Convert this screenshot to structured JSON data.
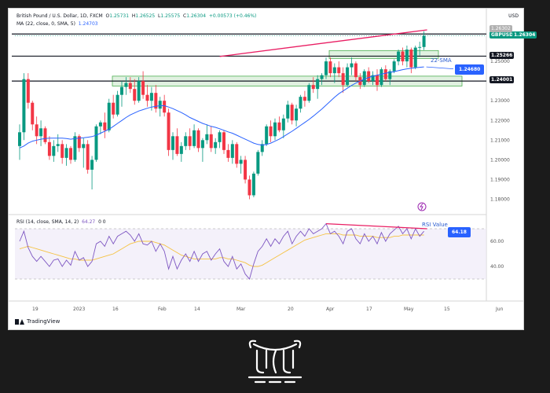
{
  "legend": {
    "symbol_line": "British Pound / U.S. Dollar, 1D, FXCM",
    "o_label": "O",
    "o_value": "1.25731",
    "h_label": "H",
    "h_value": "1.26525",
    "l_label": "L",
    "l_value": "1.25575",
    "c_label": "C",
    "c_value": "1.26304",
    "change": "+0.00573 (+0.46%)",
    "ma_line": "MA (22, close, 0, SMA, 5)",
    "ma_value": "1.24703",
    "rsi_line": "RSI (14, close, SMA, 14, 2)",
    "rsi_value": "64.27",
    "rsi_extra": "0 0"
  },
  "axis_currency": "USD",
  "branding": "TradingView",
  "price_tags": {
    "symbol": "GBPUSD",
    "last": "1.26304",
    "top_partial": "1.26302",
    "resistance_1": "1.25266",
    "resistance_2": "1.24001",
    "sma_value": "1.24680",
    "rsi_value": "64.18"
  },
  "annotations": {
    "sma_label": "22-SMA",
    "rsi_label": "RSI Value"
  },
  "colors": {
    "up": "#089981",
    "down": "#f23645",
    "sma": "#2962ff",
    "rsi": "#7e57c2",
    "rsi_ma": "#f5c242",
    "divergence": "#e91e63",
    "zone_fill": "#c8e6c9",
    "zone_stroke": "#4caf50",
    "page_bg": "#1b1b1b"
  },
  "chart_data": {
    "type": "candlestick",
    "y_range": [
      1.175,
      1.268
    ],
    "y_ticks": [
      "1.18000",
      "1.19000",
      "1.20000",
      "1.21000",
      "1.22000",
      "1.23000",
      "1.25000"
    ],
    "x_ticks": [
      "19",
      "2023",
      "16",
      "Feb",
      "14",
      "Mar",
      "20",
      "Apr",
      "17",
      "May",
      "15",
      "Jun"
    ],
    "rsi_range": [
      25,
      75
    ],
    "rsi_ticks": [
      "60.00",
      "40.00"
    ],
    "rsi_levels": [
      70,
      30
    ],
    "horizontal_levels": [
      1.2639,
      1.25266,
      1.24001
    ],
    "zones": [
      {
        "low": 1.2375,
        "high": 1.2425
      },
      {
        "low": 1.2515,
        "high": 1.2555
      }
    ],
    "candles": [
      [
        1.207,
        1.218,
        1.2,
        1.214
      ],
      [
        1.214,
        1.244,
        1.21,
        1.241
      ],
      [
        1.241,
        1.244,
        1.226,
        1.229
      ],
      [
        1.229,
        1.23,
        1.215,
        1.218
      ],
      [
        1.218,
        1.222,
        1.208,
        1.212
      ],
      [
        1.212,
        1.22,
        1.207,
        1.216
      ],
      [
        1.216,
        1.217,
        1.208,
        1.209
      ],
      [
        1.209,
        1.212,
        1.2,
        1.202
      ],
      [
        1.202,
        1.21,
        1.199,
        1.207
      ],
      [
        1.207,
        1.213,
        1.204,
        1.208
      ],
      [
        1.208,
        1.21,
        1.198,
        1.201
      ],
      [
        1.201,
        1.208,
        1.197,
        1.206
      ],
      [
        1.206,
        1.207,
        1.198,
        1.2
      ],
      [
        1.2,
        1.214,
        1.199,
        1.212
      ],
      [
        1.212,
        1.213,
        1.204,
        1.206
      ],
      [
        1.206,
        1.211,
        1.196,
        1.208
      ],
      [
        1.208,
        1.21,
        1.193,
        1.195
      ],
      [
        1.195,
        1.202,
        1.185,
        1.2
      ],
      [
        1.2,
        1.218,
        1.199,
        1.217
      ],
      [
        1.217,
        1.22,
        1.213,
        1.219
      ],
      [
        1.219,
        1.224,
        1.211,
        1.215
      ],
      [
        1.215,
        1.231,
        1.214,
        1.229
      ],
      [
        1.229,
        1.233,
        1.221,
        1.223
      ],
      [
        1.223,
        1.235,
        1.222,
        1.233
      ],
      [
        1.233,
        1.24,
        1.227,
        1.237
      ],
      [
        1.237,
        1.242,
        1.233,
        1.239
      ],
      [
        1.239,
        1.242,
        1.234,
        1.236
      ],
      [
        1.236,
        1.241,
        1.228,
        1.23
      ],
      [
        1.23,
        1.242,
        1.229,
        1.24
      ],
      [
        1.24,
        1.245,
        1.231,
        1.233
      ],
      [
        1.233,
        1.238,
        1.227,
        1.23
      ],
      [
        1.23,
        1.237,
        1.225,
        1.234
      ],
      [
        1.234,
        1.238,
        1.224,
        1.226
      ],
      [
        1.226,
        1.232,
        1.222,
        1.23
      ],
      [
        1.23,
        1.233,
        1.222,
        1.224
      ],
      [
        1.224,
        1.226,
        1.202,
        1.205
      ],
      [
        1.205,
        1.214,
        1.2,
        1.212
      ],
      [
        1.212,
        1.216,
        1.202,
        1.203
      ],
      [
        1.203,
        1.209,
        1.199,
        1.207
      ],
      [
        1.207,
        1.214,
        1.205,
        1.212
      ],
      [
        1.212,
        1.216,
        1.205,
        1.207
      ],
      [
        1.207,
        1.218,
        1.206,
        1.215
      ],
      [
        1.215,
        1.216,
        1.204,
        1.206
      ],
      [
        1.206,
        1.211,
        1.199,
        1.21
      ],
      [
        1.21,
        1.218,
        1.208,
        1.213
      ],
      [
        1.213,
        1.217,
        1.204,
        1.206
      ],
      [
        1.206,
        1.211,
        1.203,
        1.209
      ],
      [
        1.209,
        1.215,
        1.206,
        1.214
      ],
      [
        1.214,
        1.215,
        1.203,
        1.205
      ],
      [
        1.205,
        1.208,
        1.199,
        1.201
      ],
      [
        1.201,
        1.21,
        1.198,
        1.208
      ],
      [
        1.208,
        1.209,
        1.196,
        1.198
      ],
      [
        1.198,
        1.202,
        1.193,
        1.2
      ],
      [
        1.2,
        1.202,
        1.188,
        1.19
      ],
      [
        1.19,
        1.192,
        1.18,
        1.182
      ],
      [
        1.182,
        1.194,
        1.181,
        1.193
      ],
      [
        1.193,
        1.205,
        1.192,
        1.204
      ],
      [
        1.204,
        1.21,
        1.202,
        1.208
      ],
      [
        1.208,
        1.218,
        1.207,
        1.217
      ],
      [
        1.217,
        1.22,
        1.209,
        1.212
      ],
      [
        1.212,
        1.221,
        1.21,
        1.219
      ],
      [
        1.219,
        1.222,
        1.214,
        1.215
      ],
      [
        1.215,
        1.223,
        1.211,
        1.221
      ],
      [
        1.221,
        1.23,
        1.219,
        1.228
      ],
      [
        1.228,
        1.229,
        1.218,
        1.22
      ],
      [
        1.22,
        1.228,
        1.217,
        1.226
      ],
      [
        1.226,
        1.233,
        1.224,
        1.232
      ],
      [
        1.232,
        1.235,
        1.227,
        1.23
      ],
      [
        1.23,
        1.239,
        1.229,
        1.238
      ],
      [
        1.238,
        1.242,
        1.234,
        1.236
      ],
      [
        1.236,
        1.243,
        1.231,
        1.241
      ],
      [
        1.241,
        1.244,
        1.238,
        1.243
      ],
      [
        1.243,
        1.252,
        1.241,
        1.25
      ],
      [
        1.25,
        1.252,
        1.242,
        1.244
      ],
      [
        1.244,
        1.249,
        1.239,
        1.247
      ],
      [
        1.247,
        1.25,
        1.242,
        1.244
      ],
      [
        1.244,
        1.247,
        1.234,
        1.238
      ],
      [
        1.238,
        1.249,
        1.237,
        1.247
      ],
      [
        1.247,
        1.252,
        1.243,
        1.249
      ],
      [
        1.249,
        1.25,
        1.24,
        1.242
      ],
      [
        1.242,
        1.244,
        1.236,
        1.238
      ],
      [
        1.238,
        1.246,
        1.237,
        1.245
      ],
      [
        1.245,
        1.247,
        1.239,
        1.24
      ],
      [
        1.24,
        1.245,
        1.238,
        1.243
      ],
      [
        1.243,
        1.246,
        1.235,
        1.238
      ],
      [
        1.238,
        1.247,
        1.237,
        1.246
      ],
      [
        1.246,
        1.248,
        1.24,
        1.241
      ],
      [
        1.241,
        1.246,
        1.238,
        1.245
      ],
      [
        1.245,
        1.251,
        1.244,
        1.25
      ],
      [
        1.25,
        1.256,
        1.248,
        1.255
      ],
      [
        1.255,
        1.257,
        1.248,
        1.25
      ],
      [
        1.25,
        1.258,
        1.247,
        1.256
      ],
      [
        1.256,
        1.257,
        1.244,
        1.247
      ],
      [
        1.247,
        1.258,
        1.246,
        1.257
      ],
      [
        1.257,
        1.26,
        1.253,
        1.2573
      ],
      [
        1.2573,
        1.2653,
        1.2558,
        1.263
      ]
    ],
    "sma": [
      1.206,
      1.207,
      1.2085,
      1.2095,
      1.21,
      1.2105,
      1.2108,
      1.211,
      1.211,
      1.211,
      1.211,
      1.2108,
      1.2105,
      1.2108,
      1.211,
      1.2112,
      1.2115,
      1.2118,
      1.2125,
      1.2135,
      1.2145,
      1.2155,
      1.217,
      1.2185,
      1.22,
      1.2215,
      1.2228,
      1.2238,
      1.2248,
      1.2255,
      1.2262,
      1.2268,
      1.2272,
      1.2275,
      1.2275,
      1.2268,
      1.226,
      1.225,
      1.224,
      1.2228,
      1.2215,
      1.2205,
      1.2195,
      1.2185,
      1.2178,
      1.217,
      1.2165,
      1.2158,
      1.215,
      1.2142,
      1.2135,
      1.2125,
      1.2115,
      1.2105,
      1.2095,
      1.2085,
      1.2078,
      1.2075,
      1.2078,
      1.2085,
      1.2095,
      1.2105,
      1.2118,
      1.2132,
      1.2145,
      1.216,
      1.2175,
      1.219,
      1.2205,
      1.2222,
      1.224,
      1.2258,
      1.2278,
      1.2298,
      1.2318,
      1.2336,
      1.235,
      1.2364,
      1.2378,
      1.239,
      1.24,
      1.241,
      1.2418,
      1.2425,
      1.243,
      1.2435,
      1.244,
      1.2444,
      1.2448,
      1.2453,
      1.2458,
      1.2462,
      1.2465,
      1.2468,
      1.247,
      1.2472
    ],
    "rsi": [
      60,
      68,
      55,
      48,
      44,
      48,
      44,
      40,
      45,
      46,
      40,
      45,
      41,
      52,
      45,
      47,
      40,
      44,
      58,
      60,
      56,
      64,
      58,
      64,
      66,
      68,
      65,
      60,
      66,
      58,
      57,
      60,
      52,
      58,
      52,
      38,
      48,
      38,
      45,
      50,
      44,
      52,
      44,
      50,
      52,
      45,
      50,
      54,
      44,
      40,
      48,
      38,
      42,
      34,
      30,
      42,
      52,
      56,
      62,
      56,
      62,
      58,
      64,
      68,
      58,
      64,
      68,
      64,
      70,
      66,
      68,
      70,
      74,
      66,
      68,
      64,
      58,
      68,
      70,
      62,
      58,
      66,
      60,
      64,
      58,
      67,
      60,
      66,
      69,
      72,
      66,
      70,
      62,
      70,
      64,
      68
    ],
    "rsi_ma": [
      54,
      55,
      56,
      55,
      54,
      53,
      52,
      51,
      50,
      49,
      48,
      47,
      46,
      46,
      45,
      45,
      45,
      45,
      46,
      47,
      48,
      49,
      50,
      52,
      54,
      56,
      58,
      59,
      60,
      60,
      60,
      60,
      59,
      58,
      57,
      55,
      53,
      51,
      49,
      48,
      47,
      46,
      46,
      46,
      46,
      46,
      46,
      47,
      47,
      46,
      46,
      45,
      44,
      43,
      41,
      40,
      40,
      41,
      43,
      45,
      47,
      49,
      51,
      53,
      55,
      57,
      59,
      61,
      62,
      63,
      64,
      65,
      66,
      66,
      66,
      66,
      65,
      65,
      65,
      65,
      64,
      64,
      64,
      64,
      63,
      63,
      63,
      63,
      64,
      64,
      65,
      65,
      65,
      65,
      65,
      65
    ]
  }
}
